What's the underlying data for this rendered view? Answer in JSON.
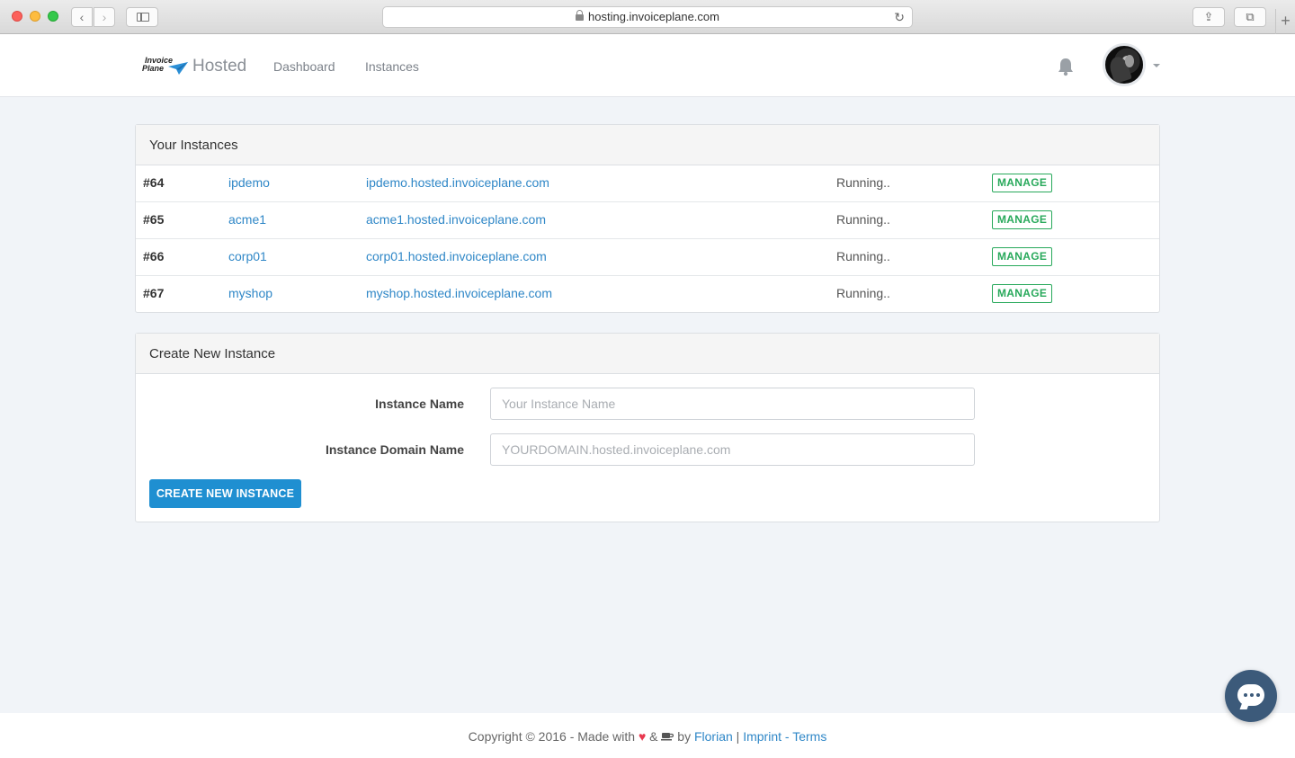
{
  "browser": {
    "url": "hosting.invoiceplane.com",
    "back_icon": "chevron-left-icon",
    "forward_icon": "chevron-right-icon"
  },
  "navbar": {
    "logo_line1": "Invoice",
    "logo_line2": "Plane",
    "brand": "Hosted",
    "links": [
      "Dashboard",
      "Instances"
    ],
    "icons": [
      "bell-icon",
      "avatar",
      "caret-down-icon"
    ]
  },
  "instances_panel": {
    "title": "Your Instances",
    "rows": [
      {
        "id": "#64",
        "name": "ipdemo",
        "domain": "ipdemo.hosted.invoiceplane.com",
        "status": "Running..",
        "action": "MANAGE"
      },
      {
        "id": "#65",
        "name": "acme1",
        "domain": "acme1.hosted.invoiceplane.com",
        "status": "Running..",
        "action": "MANAGE"
      },
      {
        "id": "#66",
        "name": "corp01",
        "domain": "corp01.hosted.invoiceplane.com",
        "status": "Running..",
        "action": "MANAGE"
      },
      {
        "id": "#67",
        "name": "myshop",
        "domain": "myshop.hosted.invoiceplane.com",
        "status": "Running..",
        "action": "MANAGE"
      }
    ]
  },
  "create_panel": {
    "title": "Create New Instance",
    "name_label": "Instance Name",
    "name_placeholder": "Your Instance Name",
    "name_value": "",
    "domain_label": "Instance Domain Name",
    "domain_placeholder": "YOURDOMAIN.hosted.invoiceplane.com",
    "domain_value": "",
    "submit_label": "CREATE NEW INSTANCE"
  },
  "footer": {
    "prefix": "Copyright © 2016 - Made with",
    "amp": "&",
    "by": "by",
    "author": "Florian",
    "sep": "|",
    "imprint": "Imprint",
    "dash": "-",
    "terms": "Terms"
  },
  "colors": {
    "link": "#2f87c7",
    "success": "#28a95b",
    "primary_button": "#1f8fd1",
    "page_bg": "#f1f4f8",
    "chat_button": "#3c5a7a"
  }
}
